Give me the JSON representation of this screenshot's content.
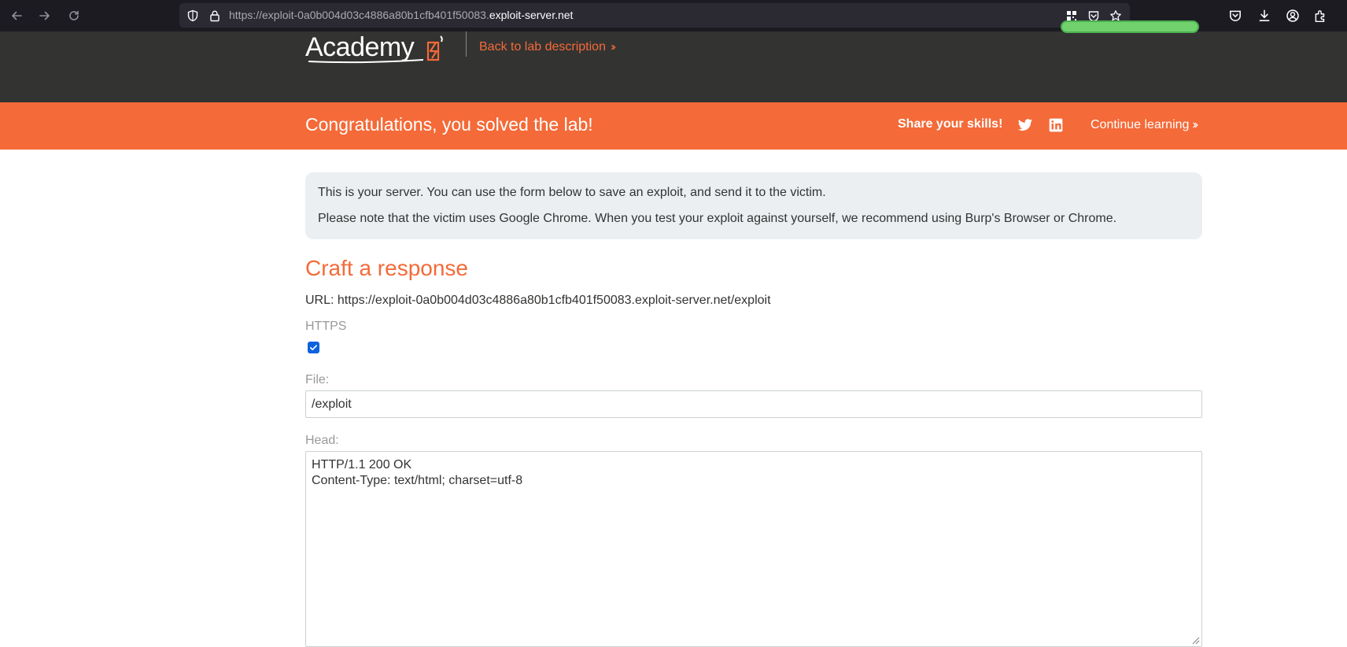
{
  "browser": {
    "url_prefix": "https://exploit-0a0b004d03c4886a80b1cfb401f50083.",
    "url_domain": "exploit-server.net",
    "icons": {
      "back": "arrow-left-icon",
      "forward": "arrow-right-icon",
      "reload": "reload-icon",
      "tracking": "shield-icon",
      "secure": "lock-icon",
      "qr": "qr-code-icon",
      "reader": "pocket-save-icon",
      "bookmark": "star-icon",
      "pocket": "pocket-icon",
      "downloads": "download-icon",
      "account": "account-icon",
      "extensions": "extensions-icon"
    }
  },
  "header": {
    "logo_text": "Academy",
    "back_link": "Back to lab description",
    "accent_color": "#f46a38",
    "background_color": "#333332"
  },
  "banner": {
    "title": "Congratulations, you solved the lab!",
    "share_label": "Share your skills!",
    "continue_link": "Continue learning",
    "background_color": "#f46a38",
    "icons": {
      "twitter": "twitter-icon",
      "linkedin": "linkedin-icon"
    }
  },
  "info": {
    "line1": "This is your server. You can use the form below to save an exploit, and send it to the victim.",
    "line2": "Please note that the victim uses Google Chrome. When you test your exploit against yourself, we recommend using Burp's Browser or Chrome."
  },
  "form": {
    "title": "Craft a response",
    "url_text": "URL: https://exploit-0a0b004d03c4886a80b1cfb401f50083.exploit-server.net/exploit",
    "https_label": "HTTPS",
    "https_checked": true,
    "file_label": "File:",
    "file_value": "/exploit",
    "head_label": "Head:",
    "head_lines": [
      "HTTP/1.1 200 OK",
      "Content-Type: text/html; charset=utf-8"
    ]
  }
}
